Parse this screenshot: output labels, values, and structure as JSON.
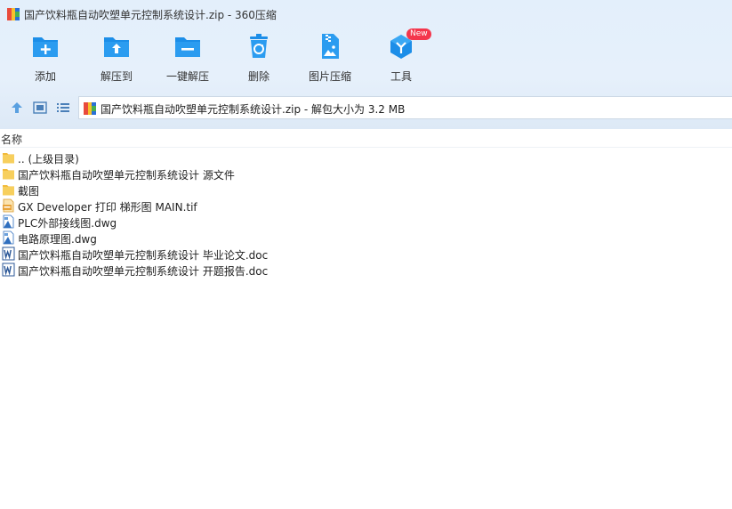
{
  "window": {
    "title": "国产饮料瓶自动吹塑单元控制系统设计.zip - 360压缩",
    "icon": "zip-archive-icon"
  },
  "toolbar": {
    "items": [
      {
        "label": "添加",
        "icon": "add-folder-icon"
      },
      {
        "label": "解压到",
        "icon": "extract-to-folder-icon"
      },
      {
        "label": "一键解压",
        "icon": "one-click-extract-icon"
      },
      {
        "label": "删除",
        "icon": "recycle-bin-icon"
      },
      {
        "label": "图片压缩",
        "icon": "image-compress-icon"
      },
      {
        "label": "工具",
        "icon": "tools-cube-icon",
        "badge": "New"
      }
    ]
  },
  "nav": {
    "path": "国产饮料瓶自动吹塑单元控制系统设计.zip - 解包大小为 3.2 MB"
  },
  "columns": {
    "name": "名称"
  },
  "files": [
    {
      "name": ".. (上级目录)",
      "icon": "folder-icon"
    },
    {
      "name": "国产饮料瓶自动吹塑单元控制系统设计 源文件",
      "icon": "folder-icon"
    },
    {
      "name": "截图",
      "icon": "folder-icon"
    },
    {
      "name": "GX Developer 打印 梯形图 MAIN.tif",
      "icon": "tif-image-icon"
    },
    {
      "name": "PLC外部接线图.dwg",
      "icon": "dwg-file-icon"
    },
    {
      "name": "电路原理图.dwg",
      "icon": "dwg-file-icon"
    },
    {
      "name": "国产饮料瓶自动吹塑单元控制系统设计 毕业论文.doc",
      "icon": "word-doc-icon"
    },
    {
      "name": "国产饮料瓶自动吹塑单元控制系统设计 开题报告.doc",
      "icon": "word-doc-icon"
    }
  ],
  "colors": {
    "accent": "#1c8ee8",
    "folder": "#f7c947",
    "header_bg": "#e3effb",
    "badge": "#f4364c"
  }
}
